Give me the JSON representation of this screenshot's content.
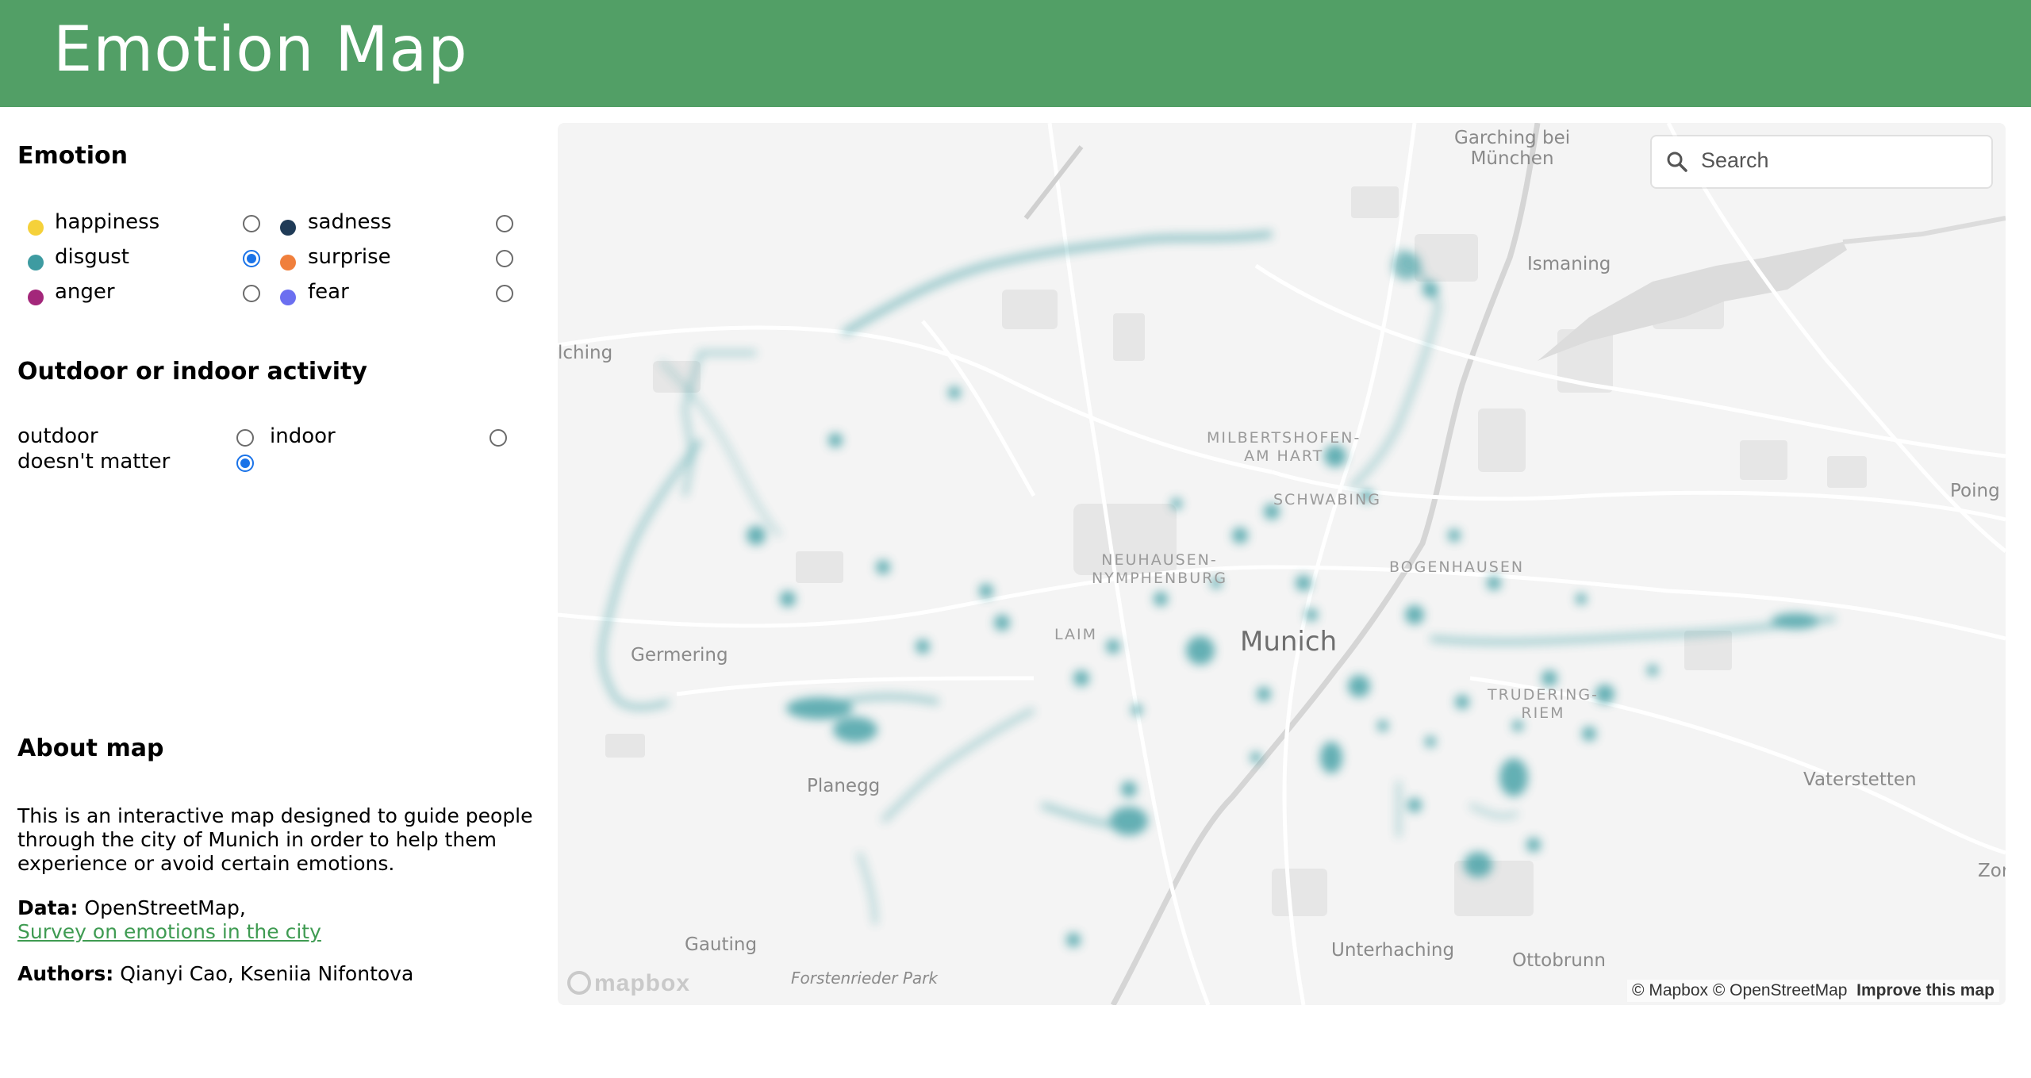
{
  "header": {
    "title": "Emotion Map",
    "background": "#529f66"
  },
  "emotion": {
    "title": "Emotion",
    "options": [
      {
        "label": "happiness",
        "color": "#f5d13a",
        "selected": false
      },
      {
        "label": "sadness",
        "color": "#1f3b57",
        "selected": false
      },
      {
        "label": "disgust",
        "color": "#3e9ba1",
        "selected": true
      },
      {
        "label": "surprise",
        "color": "#f07f3c",
        "selected": false
      },
      {
        "label": "anger",
        "color": "#a3277a",
        "selected": false
      },
      {
        "label": "fear",
        "color": "#6b6ff0",
        "selected": false
      }
    ]
  },
  "activity": {
    "title": "Outdoor or indoor activity",
    "options": [
      {
        "label": "outdoor",
        "selected": false
      },
      {
        "label": "indoor",
        "selected": false
      },
      {
        "label": "doesn't matter",
        "selected": true
      }
    ]
  },
  "about": {
    "title": "About map",
    "description": "This is an interactive map designed to guide people through the city of Munich in order to help them experience or avoid certain emotions.",
    "data_label": "Data:",
    "data_text": "OpenStreetMap,",
    "data_link": "Survey on emotions in the city",
    "authors_label": "Authors:",
    "authors_text": "Qianyi Cao, Kseniia Nifontova"
  },
  "map": {
    "search_placeholder": "Search",
    "heat_color": "#4aa3a8",
    "places": {
      "garching": "Garching bei",
      "garching2": "München",
      "ismaning": "Ismaning",
      "aching": "lching",
      "poing": "Poing",
      "milbertshofen": "MILBERTSHOFEN-",
      "amhart": "AM HART",
      "schwabing": "SCHWABING",
      "neuhausen": "NEUHAUSEN-",
      "nymphenburg": "NYMPHENBURG",
      "bogenhausen": "BOGENHAUSEN",
      "laim": "LAIM",
      "munich": "Munich",
      "germering": "Germering",
      "trudering": "TRUDERING-",
      "riem": "RIEM",
      "planegg": "Planegg",
      "vaterstetten": "Vaterstetten",
      "zor": "Zor",
      "gauting": "Gauting",
      "forstenrieder": "Forstenrieder Park",
      "unterhaching": "Unterhaching",
      "ottobrunn": "Ottobrunn"
    },
    "logo": "mapbox",
    "attribution": "© Mapbox © OpenStreetMap",
    "improve": "Improve this map"
  }
}
